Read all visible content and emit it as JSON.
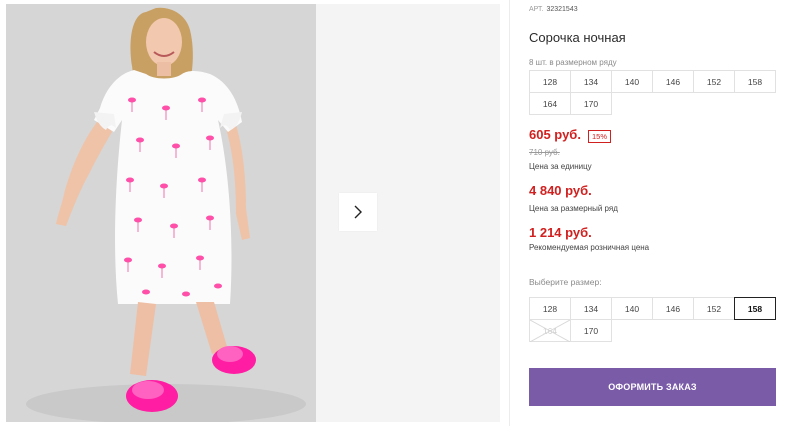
{
  "product": {
    "sku_label": "АРТ.",
    "sku_value": "32321543",
    "title": "Сорочка ночная"
  },
  "range": {
    "label": "8 шт. в размерном ряду",
    "sizes": [
      "128",
      "134",
      "140",
      "146",
      "152",
      "158",
      "164",
      "170"
    ]
  },
  "pricing": {
    "price": "605 руб.",
    "discount": "15%",
    "old_price": "710 руб.",
    "unit_label": "Цена за единицу",
    "set_price": "4 840 руб.",
    "set_label": "Цена за размерный ряд",
    "retail_price": "1 214 руб.",
    "retail_label": "Рекомендуемая розничная цена"
  },
  "size_picker": {
    "label": "Выберите размер:",
    "sizes": [
      {
        "label": "128",
        "state": "available"
      },
      {
        "label": "134",
        "state": "available"
      },
      {
        "label": "140",
        "state": "available"
      },
      {
        "label": "146",
        "state": "available"
      },
      {
        "label": "152",
        "state": "available"
      },
      {
        "label": "158",
        "state": "selected"
      },
      {
        "label": "164",
        "state": "disabled"
      },
      {
        "label": "170",
        "state": "available"
      }
    ]
  },
  "actions": {
    "order_label": "ОФОРМИТЬ ЗАКАЗ"
  },
  "gallery": {
    "next_icon": "chevron-right-icon"
  },
  "colors": {
    "accent_price": "#d0201f",
    "order_button": "#7a5ba8",
    "flamingo_pink": "#ff4fa8",
    "slipper_pink": "#ff1ea3"
  }
}
